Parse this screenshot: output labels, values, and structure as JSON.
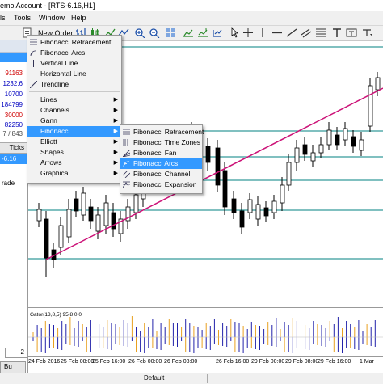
{
  "window": {
    "title": "emo Account - [RTS-6.16,H1]"
  },
  "menubar": [
    "ls",
    "Tools",
    "Window",
    "Help"
  ],
  "toolbar": {
    "new_order_label": "New Order"
  },
  "left_panel": {
    "quotes": [
      {
        "value": "91163",
        "color": "red"
      },
      {
        "value": "1232.6",
        "color": "blue"
      },
      {
        "value": "10700",
        "color": "blue"
      },
      {
        "value": "184799",
        "color": "blue"
      },
      {
        "value": "30000",
        "color": "red"
      },
      {
        "value": "82250",
        "color": "blue"
      },
      {
        "value": "7 / 843",
        "color": "black"
      }
    ],
    "ticks_tab": "Ticks",
    "symbol_fragment": "-6.16",
    "trade_fragment": "rade",
    "bottom_number": "2",
    "bottom_word": "Bu"
  },
  "first_menu": {
    "items": [
      {
        "label": "Fibonacci Retracement",
        "icon": "fibo-retracement-icon"
      },
      {
        "label": "Fibonacci Arcs",
        "icon": "fibo-arcs-icon"
      },
      {
        "label": "Vertical Line",
        "icon": "vertical-line-icon"
      },
      {
        "label": "Horizontal Line",
        "icon": "horizontal-line-icon"
      },
      {
        "label": "Trendline",
        "icon": "trendline-icon"
      }
    ],
    "submenus": [
      {
        "label": "Lines"
      },
      {
        "label": "Channels"
      },
      {
        "label": "Gann"
      },
      {
        "label": "Fibonacci",
        "highlighted": true
      },
      {
        "label": "Elliott"
      },
      {
        "label": "Shapes"
      },
      {
        "label": "Arrows"
      },
      {
        "label": "Graphical"
      }
    ]
  },
  "fibonacci_submenu": {
    "items": [
      {
        "label": "Fibonacci Retracement",
        "icon": "fibo-retracement-icon"
      },
      {
        "label": "Fibonacci Time Zones",
        "icon": "fibo-time-zones-icon"
      },
      {
        "label": "Fibonacci Fan",
        "icon": "fibo-fan-icon"
      },
      {
        "label": "Fibonacci Arcs",
        "icon": "fibo-arcs-icon",
        "highlighted": true
      },
      {
        "label": "Fibonacci Channel",
        "icon": "fibo-channel-icon"
      },
      {
        "label": "Fibonacci Expansion",
        "icon": "fibo-expansion-icon"
      }
    ]
  },
  "gator": {
    "label": "Gator(13,8,5) 95.8 0.0"
  },
  "xaxis_labels": [
    "24 Feb 2016",
    "25 Feb 08:00",
    "25 Feb 16:00",
    "26 Feb 00:00",
    "26 Feb 08:00",
    "26 Feb 16:00",
    "29 Feb 00:00",
    "29 Feb 08:00",
    "29 Feb 16:00",
    "1 Mar"
  ],
  "statusbar": {
    "profile": "Default"
  },
  "colors": {
    "up_candle": "#ffffff",
    "down_candle": "#000000",
    "trendline": "#cc1177",
    "level_lines": "#008080",
    "gator_up": "#2222aa",
    "gator_down": "#e8a020",
    "menu_highlight": "#3399ff"
  }
}
